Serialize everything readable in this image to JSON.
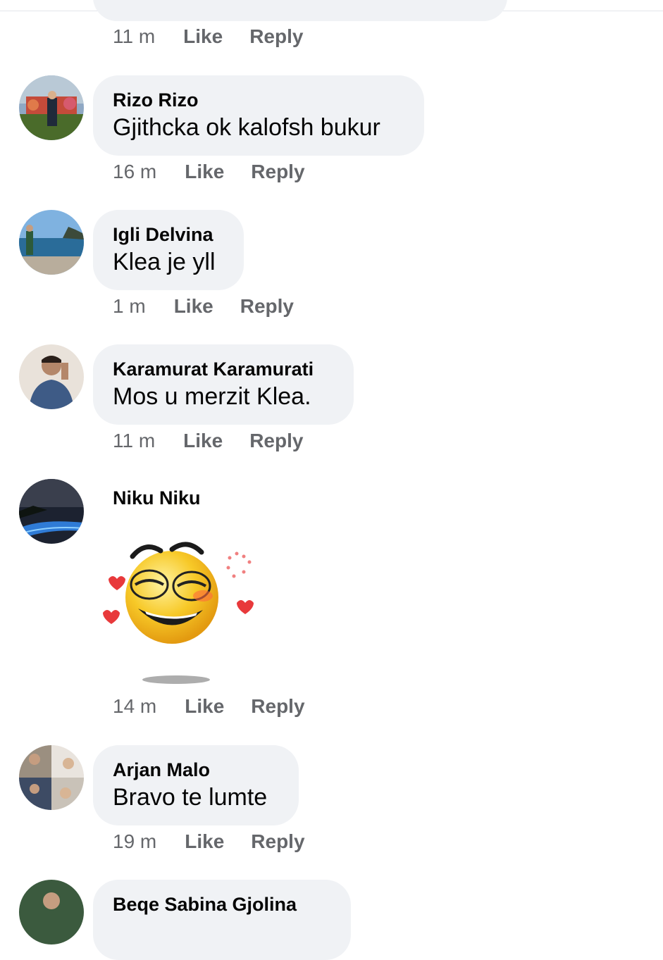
{
  "actions": {
    "like": "Like",
    "reply": "Reply"
  },
  "comments": [
    {
      "time": "11 m"
    },
    {
      "name": "Rizo Rizo",
      "text": "Gjithcka ok kalofsh bukur",
      "time": "16 m"
    },
    {
      "name": "Igli Delvina",
      "text": "Klea je yll",
      "time": "1 m"
    },
    {
      "name": "Karamurat Karamurati",
      "text": "Mos u merzit Klea.",
      "time": "11 m"
    },
    {
      "name": "Niku Niku",
      "sticker": "laughing-wink-emoji-with-hearts",
      "time": "14 m"
    },
    {
      "name": "Arjan Malo",
      "text": "Bravo te lumte",
      "time": "19 m"
    },
    {
      "name": "Beqe Sabina Gjolina"
    }
  ]
}
